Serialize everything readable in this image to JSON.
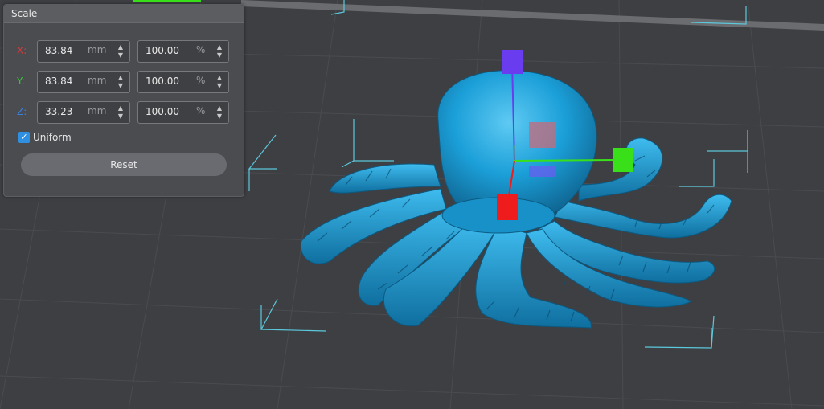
{
  "panel": {
    "title": "Scale",
    "rows": [
      {
        "axis": "X:",
        "axis_color": "#d33b3b",
        "size": "83.84",
        "size_unit": "mm",
        "percent": "100.00",
        "percent_unit": "%"
      },
      {
        "axis": "Y:",
        "axis_color": "#39c339",
        "size": "83.84",
        "size_unit": "mm",
        "percent": "100.00",
        "percent_unit": "%"
      },
      {
        "axis": "Z:",
        "axis_color": "#3a7fe0",
        "size": "33.23",
        "size_unit": "mm",
        "percent": "100.00",
        "percent_unit": "%"
      }
    ],
    "uniform_label": "Uniform",
    "uniform_checked": true,
    "reset_label": "Reset"
  },
  "colors": {
    "model": "#1b9fd8",
    "bed": "#3e3f43",
    "grid": "#4a4b50",
    "bounding_box": "#5bc8dc",
    "handle_x": "#ee1c1c",
    "handle_y": "#39e01a",
    "handle_z": "#6a3cf0"
  }
}
